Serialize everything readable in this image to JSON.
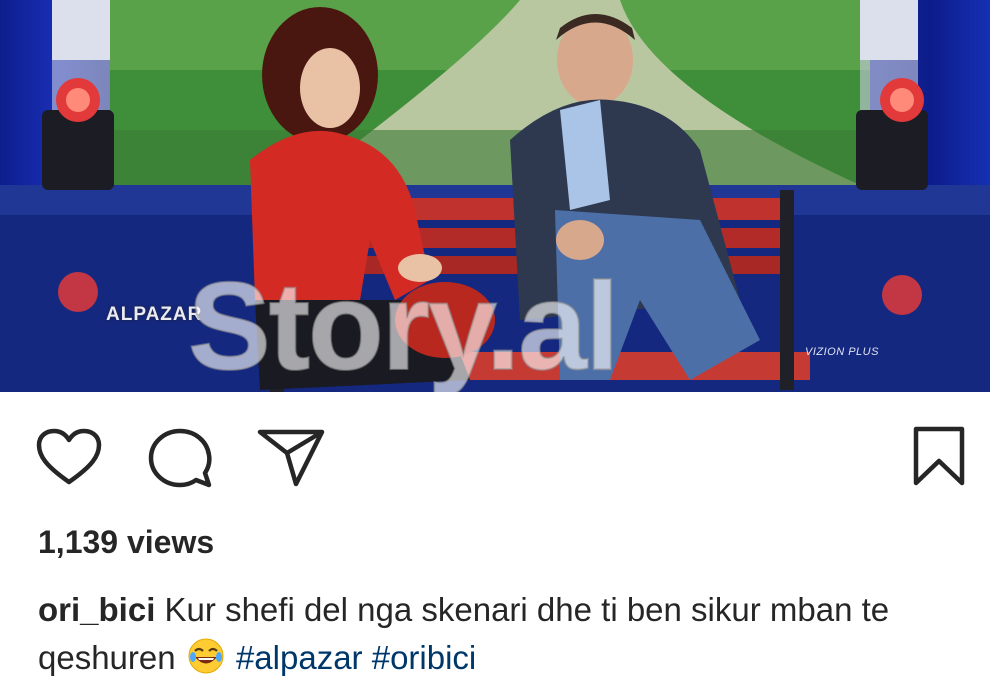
{
  "post": {
    "image_labels": {
      "show_logo": "ALPAZAR",
      "channel_logo": "VIZION PLUS",
      "watermark": "Story.al"
    },
    "actions": {
      "like": "heart-icon",
      "comment": "comment-icon",
      "share": "paper-plane-icon",
      "save": "bookmark-icon"
    },
    "views": "1,139 views",
    "caption": {
      "username": "ori_bici",
      "text": "Kur shefi del nga skenari dhe ti ben sikur mban te qeshuren",
      "emoji": "laughing-face-emoji",
      "hashtags": [
        "#alpazar",
        "#oribici"
      ]
    }
  }
}
